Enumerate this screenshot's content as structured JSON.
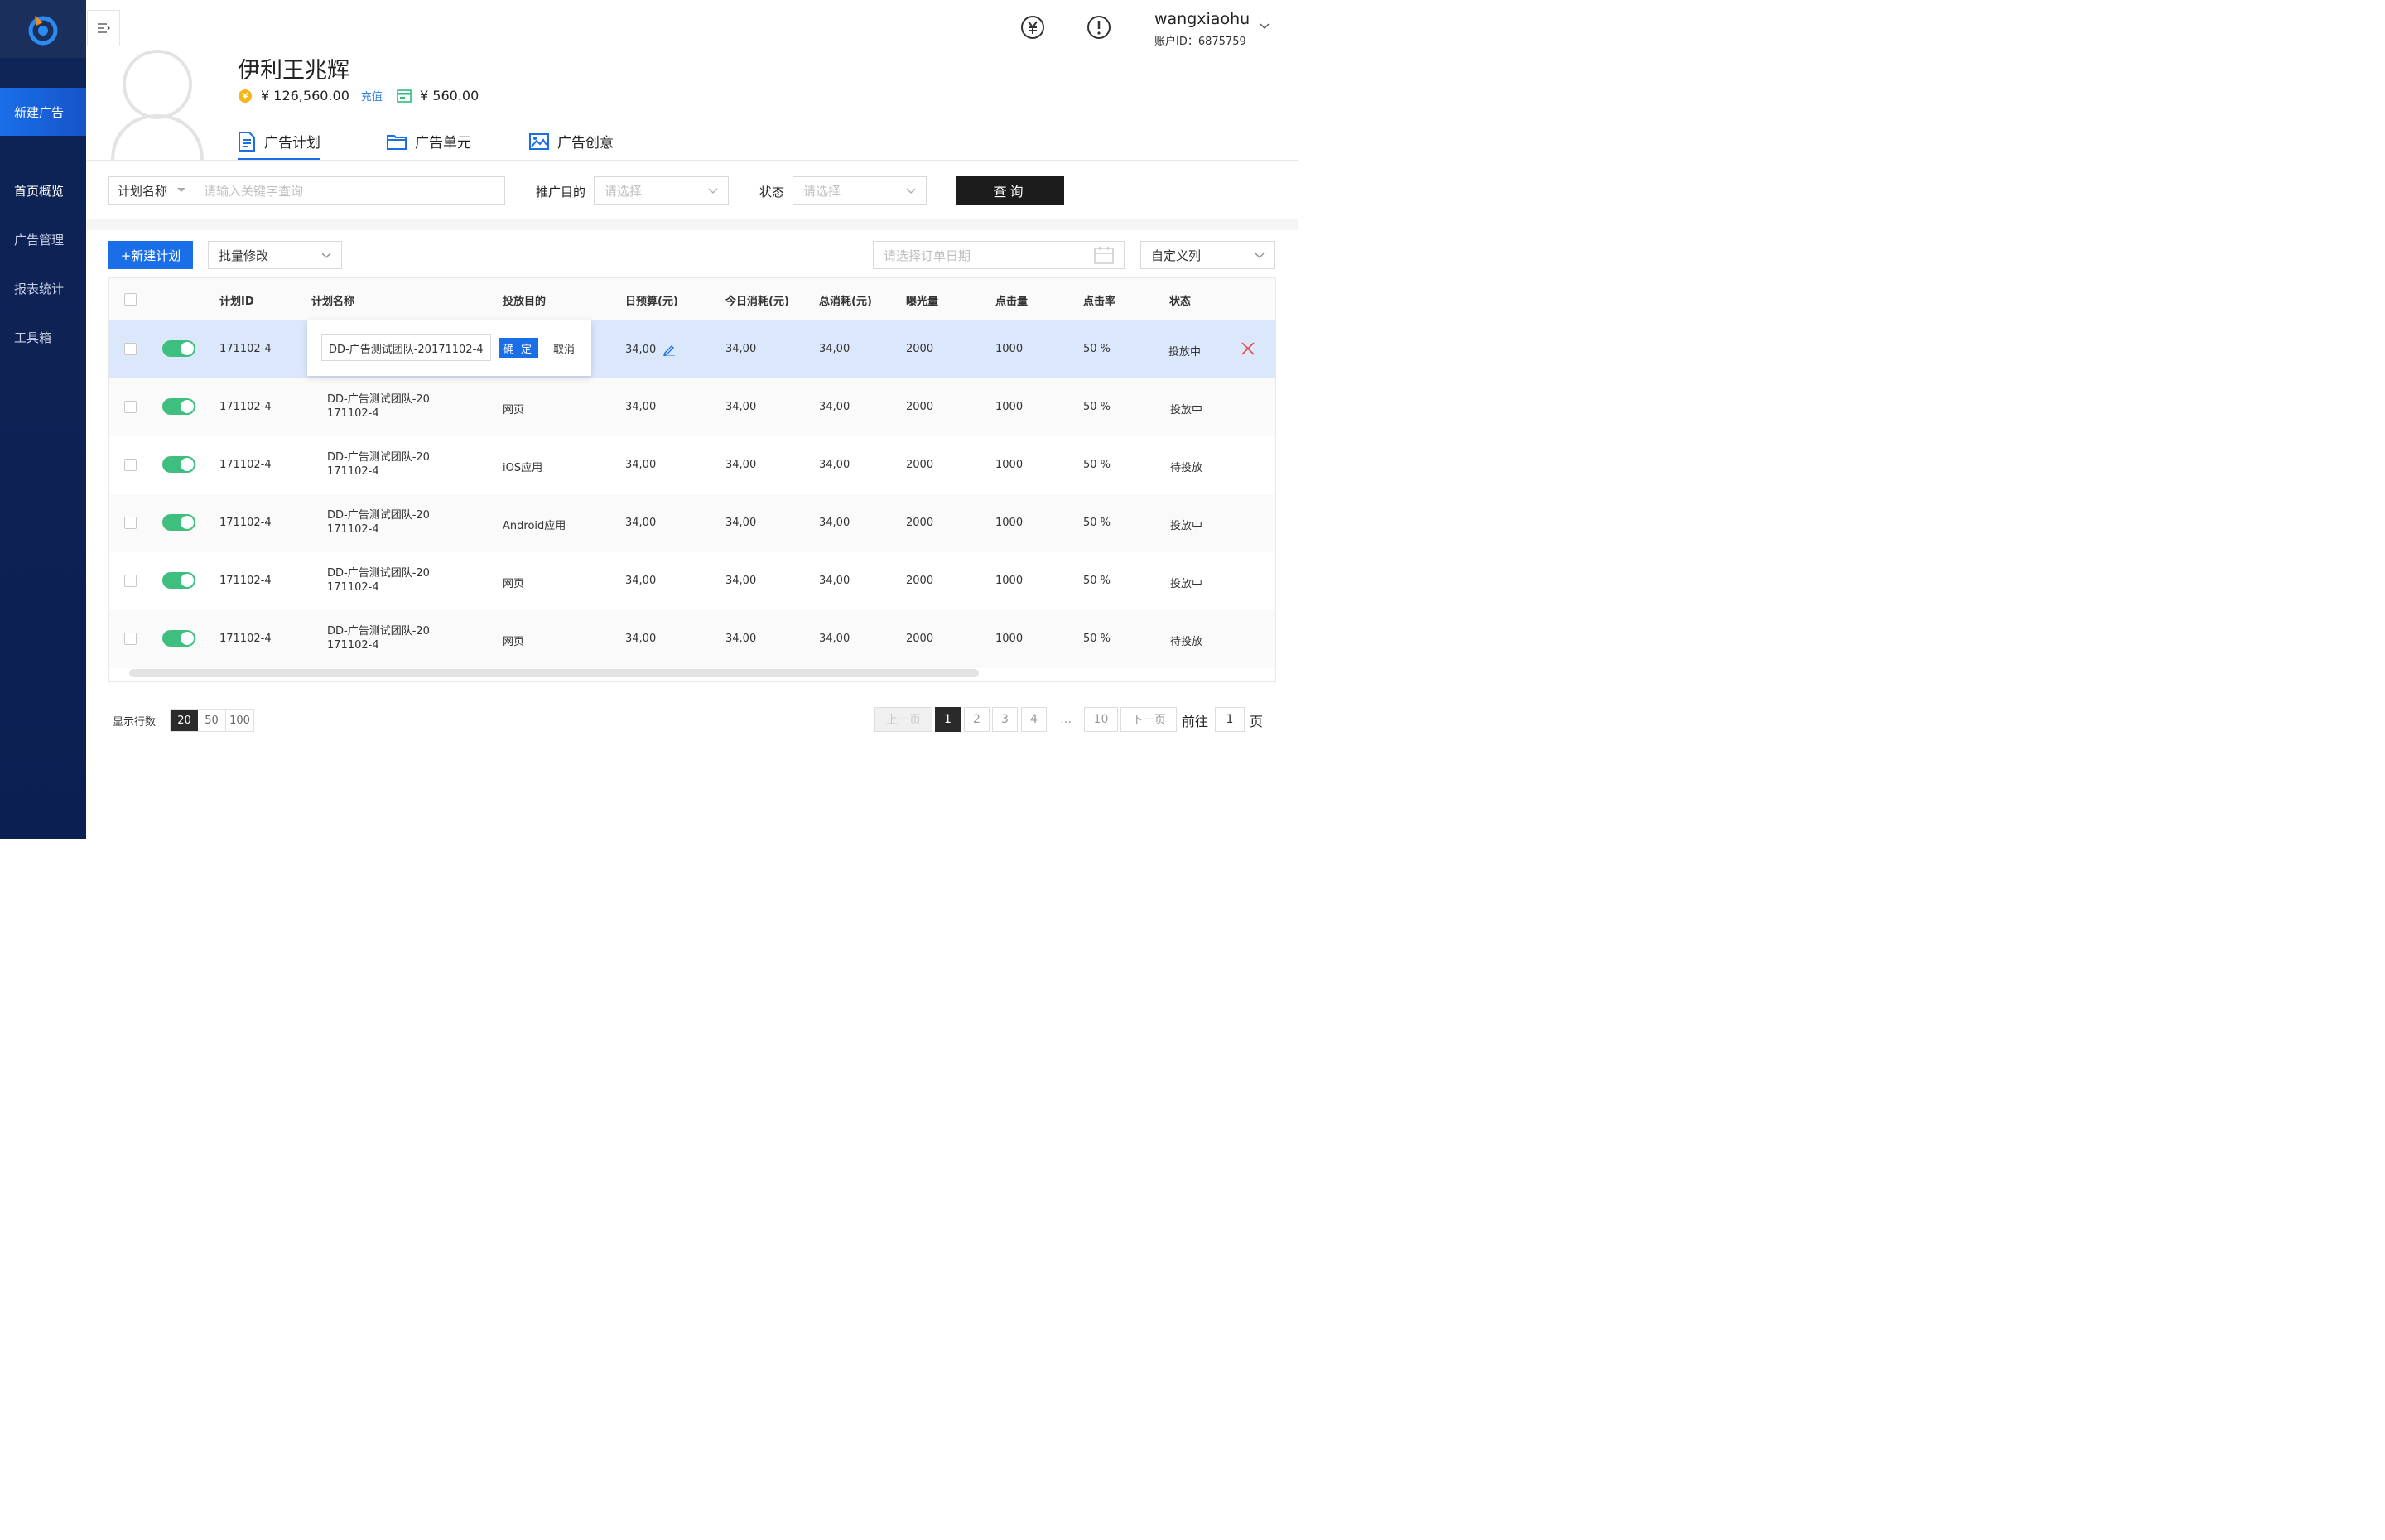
{
  "sidebar": {
    "new_ad": "新建广告",
    "items": [
      {
        "label": "首页概览",
        "active": true
      },
      {
        "label": "广告管理",
        "active": false
      },
      {
        "label": "报表统计",
        "active": false
      },
      {
        "label": "工具箱",
        "active": false
      }
    ]
  },
  "header": {
    "user_name": "wangxiaohu",
    "account_id": "账户ID：6875759",
    "icons": [
      "yen-icon",
      "alert-icon"
    ]
  },
  "profile": {
    "name": "伊利王兆辉",
    "balance": "¥ 126,560.00",
    "recharge": "充值",
    "credit": "¥ 560.00"
  },
  "tabs": [
    {
      "label": "广告计划",
      "icon": "document-icon",
      "active": true
    },
    {
      "label": "广告单元",
      "icon": "folder-icon",
      "active": false
    },
    {
      "label": "广告创意",
      "icon": "image-icon",
      "active": false
    }
  ],
  "filter": {
    "field_select": "计划名称",
    "keyword_placeholder": "请输入关键字查询",
    "purpose_label": "推广目的",
    "purpose_placeholder": "请选择",
    "status_label": "状态",
    "status_placeholder": "请选择",
    "query_button": "查询"
  },
  "toolbar": {
    "new_plan": "+新建计划",
    "batch_edit": "批量修改",
    "date_placeholder": "请选择订单日期",
    "custom_columns": "自定义列"
  },
  "table": {
    "columns": [
      "计划ID",
      "计划名称",
      "投放目的",
      "日预算(元)",
      "今日消耗(元)",
      "总消耗(元)",
      "曝光量",
      "点击量",
      "点击率",
      "状态"
    ],
    "rows": [
      {
        "id": "171102-4",
        "name1": "DD-广告测试团队-20",
        "name2": "171102-4",
        "purpose": "",
        "budget": "34,00",
        "today": "34,00",
        "total": "34,00",
        "impressions": "2000",
        "clicks": "1000",
        "ctr": "50 %",
        "status": "投放中",
        "editing": true
      },
      {
        "id": "171102-4",
        "name1": "DD-广告测试团队-20",
        "name2": "171102-4",
        "purpose": "网页",
        "budget": "34,00",
        "today": "34,00",
        "total": "34,00",
        "impressions": "2000",
        "clicks": "1000",
        "ctr": "50 %",
        "status": "投放中"
      },
      {
        "id": "171102-4",
        "name1": "DD-广告测试团队-20",
        "name2": "171102-4",
        "purpose": "iOS应用",
        "budget": "34,00",
        "today": "34,00",
        "total": "34,00",
        "impressions": "2000",
        "clicks": "1000",
        "ctr": "50 %",
        "status": "待投放"
      },
      {
        "id": "171102-4",
        "name1": "DD-广告测试团队-20",
        "name2": "171102-4",
        "purpose": "Android应用",
        "budget": "34,00",
        "today": "34,00",
        "total": "34,00",
        "impressions": "2000",
        "clicks": "1000",
        "ctr": "50 %",
        "status": "投放中"
      },
      {
        "id": "171102-4",
        "name1": "DD-广告测试团队-20",
        "name2": "171102-4",
        "purpose": "网页",
        "budget": "34,00",
        "today": "34,00",
        "total": "34,00",
        "impressions": "2000",
        "clicks": "1000",
        "ctr": "50 %",
        "status": "投放中"
      },
      {
        "id": "171102-4",
        "name1": "DD-广告测试团队-20",
        "name2": "171102-4",
        "purpose": "网页",
        "budget": "34,00",
        "today": "34,00",
        "total": "34,00",
        "impressions": "2000",
        "clicks": "1000",
        "ctr": "50 %",
        "status": "待投放"
      }
    ],
    "edit_popover": {
      "value": "DD-广告测试团队-20171102-4",
      "ok": "确 定",
      "cancel": "取消"
    }
  },
  "footer": {
    "rows_label": "显示行数",
    "rows_options": [
      "20",
      "50",
      "100"
    ],
    "rows_selected": "20",
    "prev": "上一页",
    "pages": [
      "1",
      "2",
      "3",
      "4"
    ],
    "ellipsis": "…",
    "last_page": "10",
    "next": "下一页",
    "goto_prefix": "前往",
    "goto_value": "1",
    "goto_suffix": "页"
  },
  "colors": {
    "sidebar_bg": "#0f2456",
    "accent": "#1a6ee8",
    "toggle_on": "#3fbf7f",
    "row_highlight": "#dbe8fb",
    "delete": "#e84b4b"
  }
}
